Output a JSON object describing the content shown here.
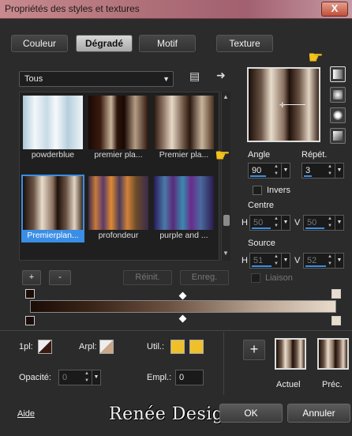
{
  "window": {
    "title": "Propriétés des styles et textures",
    "close_label": "X"
  },
  "tabs": [
    {
      "label": "Couleur",
      "active": false
    },
    {
      "label": "Dégradé",
      "active": true
    },
    {
      "label": "Motif",
      "active": false
    },
    {
      "label": "Texture",
      "active": false
    }
  ],
  "category": {
    "selected": "Tous"
  },
  "gallery": {
    "items": [
      {
        "label": "powderblue"
      },
      {
        "label": "premier pla..."
      },
      {
        "label": "Premier pla..."
      },
      {
        "label": "Premierplan...",
        "selected": true
      },
      {
        "label": "profondeur"
      },
      {
        "label": "purple and ..."
      }
    ]
  },
  "gallery_buttons": {
    "add": "+",
    "remove": "-",
    "reset": "Réinit.",
    "save": "Enreg."
  },
  "angle": {
    "label": "Angle",
    "value": "90"
  },
  "repeat": {
    "label": "Répét.",
    "value": "3"
  },
  "invert": {
    "label": "Invers"
  },
  "center": {
    "label": "Centre",
    "h_label": "H",
    "h_value": "50",
    "v_label": "V",
    "v_value": "50"
  },
  "source": {
    "label": "Source",
    "h_label": "H",
    "h_value": "51",
    "v_label": "V",
    "v_value": "52"
  },
  "link": {
    "label": "Liaison"
  },
  "bottom": {
    "pl1_label": "1pl:",
    "arpl_label": "Arpl:",
    "util_label": "Util.:",
    "opacity_label": "Opacité:",
    "opacity_value": "0",
    "empl_label": "Empl.:",
    "empl_value": "0",
    "current_label": "Actuel",
    "previous_label": "Préc.",
    "add_label": "+"
  },
  "footer": {
    "help": "Aide",
    "ok": "OK",
    "cancel": "Annuler",
    "logo": "Renée Design"
  },
  "colors": {
    "accent": "#3a8ee6",
    "highlight": "#f4c21a"
  }
}
